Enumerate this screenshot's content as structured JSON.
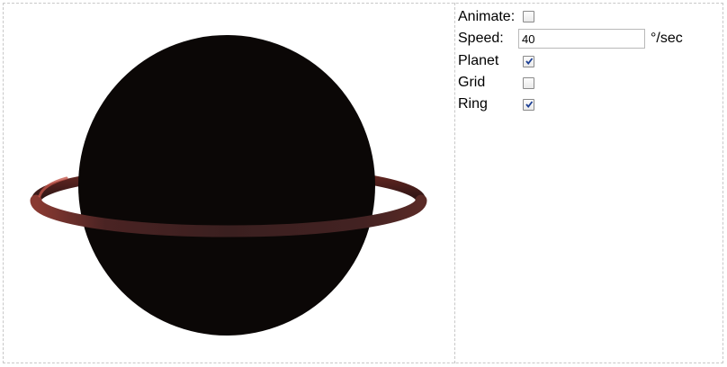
{
  "controls": {
    "animate": {
      "label": "Animate:",
      "checked": false
    },
    "speed": {
      "label": "Speed:",
      "value": "40",
      "unit": "°/sec"
    },
    "planet": {
      "label": "Planet",
      "checked": true
    },
    "grid": {
      "label": "Grid",
      "checked": false
    },
    "ring": {
      "label": "Ring",
      "checked": true
    }
  },
  "scene": {
    "planet_color": "#0b0706",
    "ring_color": "#3a1e1e",
    "ring_highlight": "#b84a3f"
  }
}
